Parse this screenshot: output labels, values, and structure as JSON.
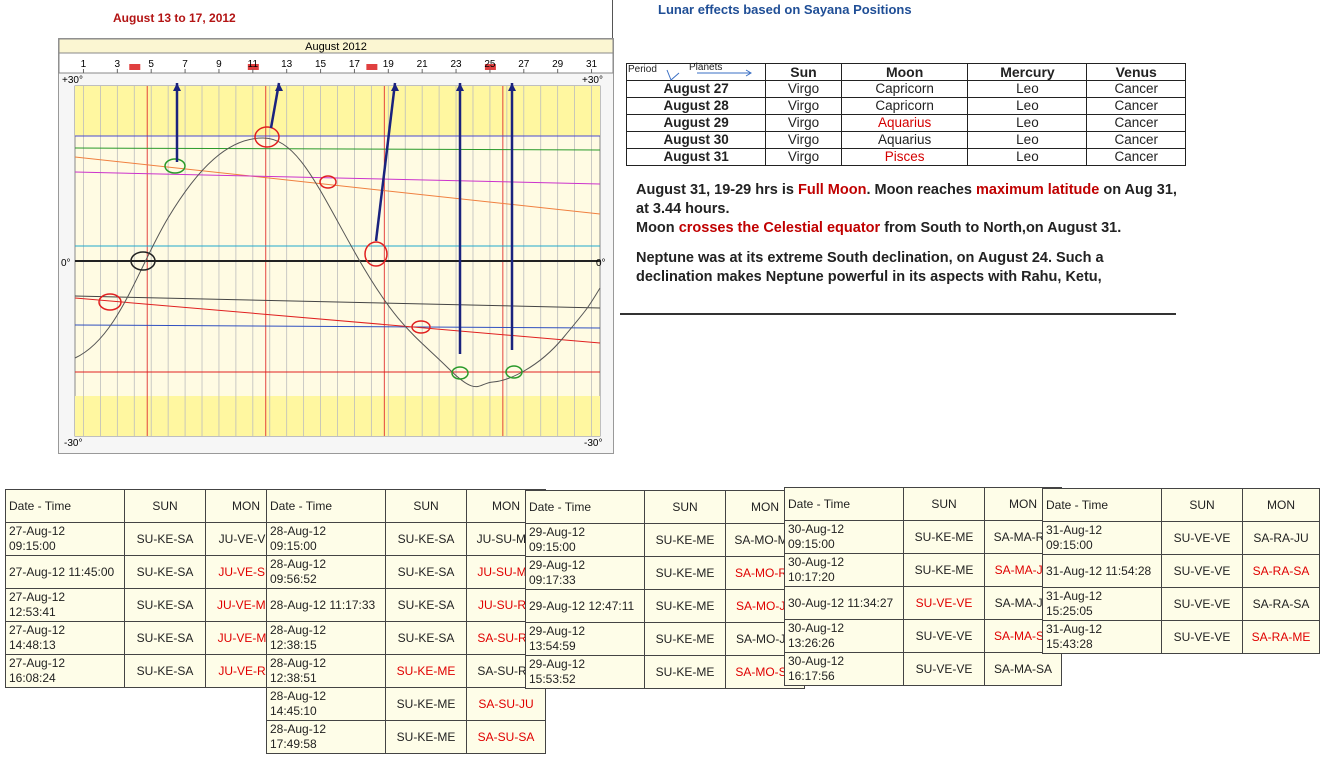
{
  "header": {
    "date_range": "August 13 to 17, 2012",
    "lunar_title": "Lunar effects based on Sayana Positions"
  },
  "chart": {
    "title": "August 2012",
    "ticks": [
      "1",
      "3",
      "5",
      "7",
      "9",
      "11",
      "13",
      "15",
      "17",
      "19",
      "21",
      "23",
      "25",
      "27",
      "29",
      "31"
    ],
    "top_left_label": "+30°",
    "top_right_label": "+30°",
    "bottom_left_label": "-30°",
    "bottom_right_label": "-30°",
    "zero_label_left": "0°",
    "zero_label_right": "0°"
  },
  "planet_table": {
    "period_label": "Period",
    "planets_label": "Planets",
    "headers": [
      "Sun",
      "Moon",
      "Mercury",
      "Venus"
    ],
    "rows": [
      {
        "date": "August 27",
        "sun": "Virgo",
        "moon": "Capricorn",
        "mercury": "Leo",
        "venus": "Cancer",
        "moon_red": false
      },
      {
        "date": "August 28",
        "sun": "Virgo",
        "moon": "Capricorn",
        "mercury": "Leo",
        "venus": "Cancer",
        "moon_red": false
      },
      {
        "date": "August 29",
        "sun": "Virgo",
        "moon": "Aquarius",
        "mercury": "Leo",
        "venus": "Cancer",
        "moon_red": true
      },
      {
        "date": "August 30",
        "sun": "Virgo",
        "moon": "Aquarius",
        "mercury": "Leo",
        "venus": "Cancer",
        "moon_red": false
      },
      {
        "date": "August 31",
        "sun": "Virgo",
        "moon": "Pisces",
        "mercury": "Leo",
        "venus": "Cancer",
        "moon_red": true
      }
    ]
  },
  "text_block": {
    "p1_a": "August 31, 19-29 hrs is ",
    "p1_hl1": "Full Moon",
    "p1_b": ". Moon reaches ",
    "p1_hl2": "maximum latitude",
    "p1_c": " on Aug 31, at 3.44 hours.",
    "p2_a": "Moon ",
    "p2_hl": "crosses the Celestial equator",
    "p2_b": " from South to North,on August 31.",
    "p3": "Neptune was at its extreme South declination, on August 24. Such a declination makes Neptune powerful in its aspects with Rahu, Ketu,"
  },
  "transit_tables": [
    {
      "headers": [
        "Date - Time",
        "SUN",
        "MON"
      ],
      "rows": [
        {
          "d1": "27-Aug-12",
          "d2": "09:15:00",
          "sun": "SU-KE-SA",
          "mon": "JU-VE-VE",
          "mon_red": false,
          "sun_red": false
        },
        {
          "d1": "27-Aug-12 11:45:00",
          "d2": "",
          "sun": "SU-KE-SA",
          "mon": "JU-VE-SU",
          "mon_red": true,
          "sun_red": false
        },
        {
          "d1": "27-Aug-12",
          "d2": "12:53:41",
          "sun": "SU-KE-SA",
          "mon": "JU-VE-MO",
          "mon_red": true,
          "sun_red": false
        },
        {
          "d1": "27-Aug-12",
          "d2": "14:48:13",
          "sun": "SU-KE-SA",
          "mon": "JU-VE-MA",
          "mon_red": true,
          "sun_red": false
        },
        {
          "d1": "27-Aug-12",
          "d2": "16:08:24",
          "sun": "SU-KE-SA",
          "mon": "JU-VE-RA",
          "mon_red": true,
          "sun_red": false
        }
      ]
    },
    {
      "headers": [
        "Date - Time",
        "SUN",
        "MON"
      ],
      "rows": [
        {
          "d1": "28-Aug-12",
          "d2": "09:15:00",
          "sun": "SU-KE-SA",
          "mon": "JU-SU-MO",
          "mon_red": false,
          "sun_red": false
        },
        {
          "d1": "28-Aug-12",
          "d2": "09:56:52",
          "sun": "SU-KE-SA",
          "mon": "JU-SU-MA",
          "mon_red": true,
          "sun_red": false
        },
        {
          "d1": "28-Aug-12 11:17:33",
          "d2": "",
          "sun": "SU-KE-SA",
          "mon": "JU-SU-RA",
          "mon_red": true,
          "sun_red": false
        },
        {
          "d1": "28-Aug-12",
          "d2": "12:38:15",
          "sun": "SU-KE-SA",
          "mon": "SA-SU-RA",
          "mon_red": true,
          "sun_red": false
        },
        {
          "d1": "28-Aug-12",
          "d2": "12:38:51",
          "sun": "SU-KE-ME",
          "mon": "SA-SU-RA",
          "mon_red": false,
          "sun_red": true
        },
        {
          "d1": "28-Aug-12",
          "d2": "14:45:10",
          "sun": "SU-KE-ME",
          "mon": "SA-SU-JU",
          "mon_red": true,
          "sun_red": false
        },
        {
          "d1": "28-Aug-12",
          "d2": "17:49:58",
          "sun": "SU-KE-ME",
          "mon": "SA-SU-SA",
          "mon_red": true,
          "sun_red": false
        }
      ]
    },
    {
      "headers": [
        "Date - Time",
        "SUN",
        "MON"
      ],
      "rows": [
        {
          "d1": "29-Aug-12",
          "d2": "09:15:00",
          "sun": "SU-KE-ME",
          "mon": "SA-MO-MA",
          "mon_red": false,
          "sun_red": false
        },
        {
          "d1": "29-Aug-12",
          "d2": "09:17:33",
          "sun": "SU-KE-ME",
          "mon": "SA-MO-RA",
          "mon_red": true,
          "sun_red": false
        },
        {
          "d1": "29-Aug-12 12:47:11",
          "d2": "",
          "sun": "SU-KE-ME",
          "mon": "SA-MO-JU",
          "mon_red": true,
          "sun_red": false
        },
        {
          "d1": "29-Aug-12",
          "d2": "13:54:59",
          "sun": "SU-KE-ME",
          "mon": "SA-MO-JU",
          "mon_red": false,
          "sun_red": false
        },
        {
          "d1": "29-Aug-12",
          "d2": "15:53:52",
          "sun": "SU-KE-ME",
          "mon": "SA-MO-SA",
          "mon_red": true,
          "sun_red": false
        }
      ]
    },
    {
      "headers": [
        "Date - Time",
        "SUN",
        "MON"
      ],
      "rows": [
        {
          "d1": "30-Aug-12",
          "d2": "09:15:00",
          "sun": "SU-KE-ME",
          "mon": "SA-MA-RA",
          "mon_red": false,
          "sun_red": false
        },
        {
          "d1": "30-Aug-12",
          "d2": "10:17:20",
          "sun": "SU-KE-ME",
          "mon": "SA-MA-JU",
          "mon_red": true,
          "sun_red": false
        },
        {
          "d1": "30-Aug-12 11:34:27",
          "d2": "",
          "sun": "SU-VE-VE",
          "mon": "SA-MA-JU",
          "mon_red": false,
          "sun_red": true
        },
        {
          "d1": "30-Aug-12",
          "d2": "13:26:26",
          "sun": "SU-VE-VE",
          "mon": "SA-MA-SA",
          "mon_red": true,
          "sun_red": false
        },
        {
          "d1": "30-Aug-12",
          "d2": "16:17:56",
          "sun": "SU-VE-VE",
          "mon": "SA-MA-SA",
          "mon_red": false,
          "sun_red": false
        }
      ]
    },
    {
      "headers": [
        "Date - Time",
        "SUN",
        "MON"
      ],
      "rows": [
        {
          "d1": "31-Aug-12",
          "d2": "09:15:00",
          "sun": "SU-VE-VE",
          "mon": "SA-RA-JU",
          "mon_red": false,
          "sun_red": false
        },
        {
          "d1": "31-Aug-12 11:54:28",
          "d2": "",
          "sun": "SU-VE-VE",
          "mon": "SA-RA-SA",
          "mon_red": true,
          "sun_red": false
        },
        {
          "d1": "31-Aug-12",
          "d2": "15:25:05",
          "sun": "SU-VE-VE",
          "mon": "SA-RA-SA",
          "mon_red": false,
          "sun_red": false
        },
        {
          "d1": "31-Aug-12",
          "d2": "15:43:28",
          "sun": "SU-VE-VE",
          "mon": "SA-RA-ME",
          "mon_red": true,
          "sun_red": false
        }
      ]
    }
  ]
}
